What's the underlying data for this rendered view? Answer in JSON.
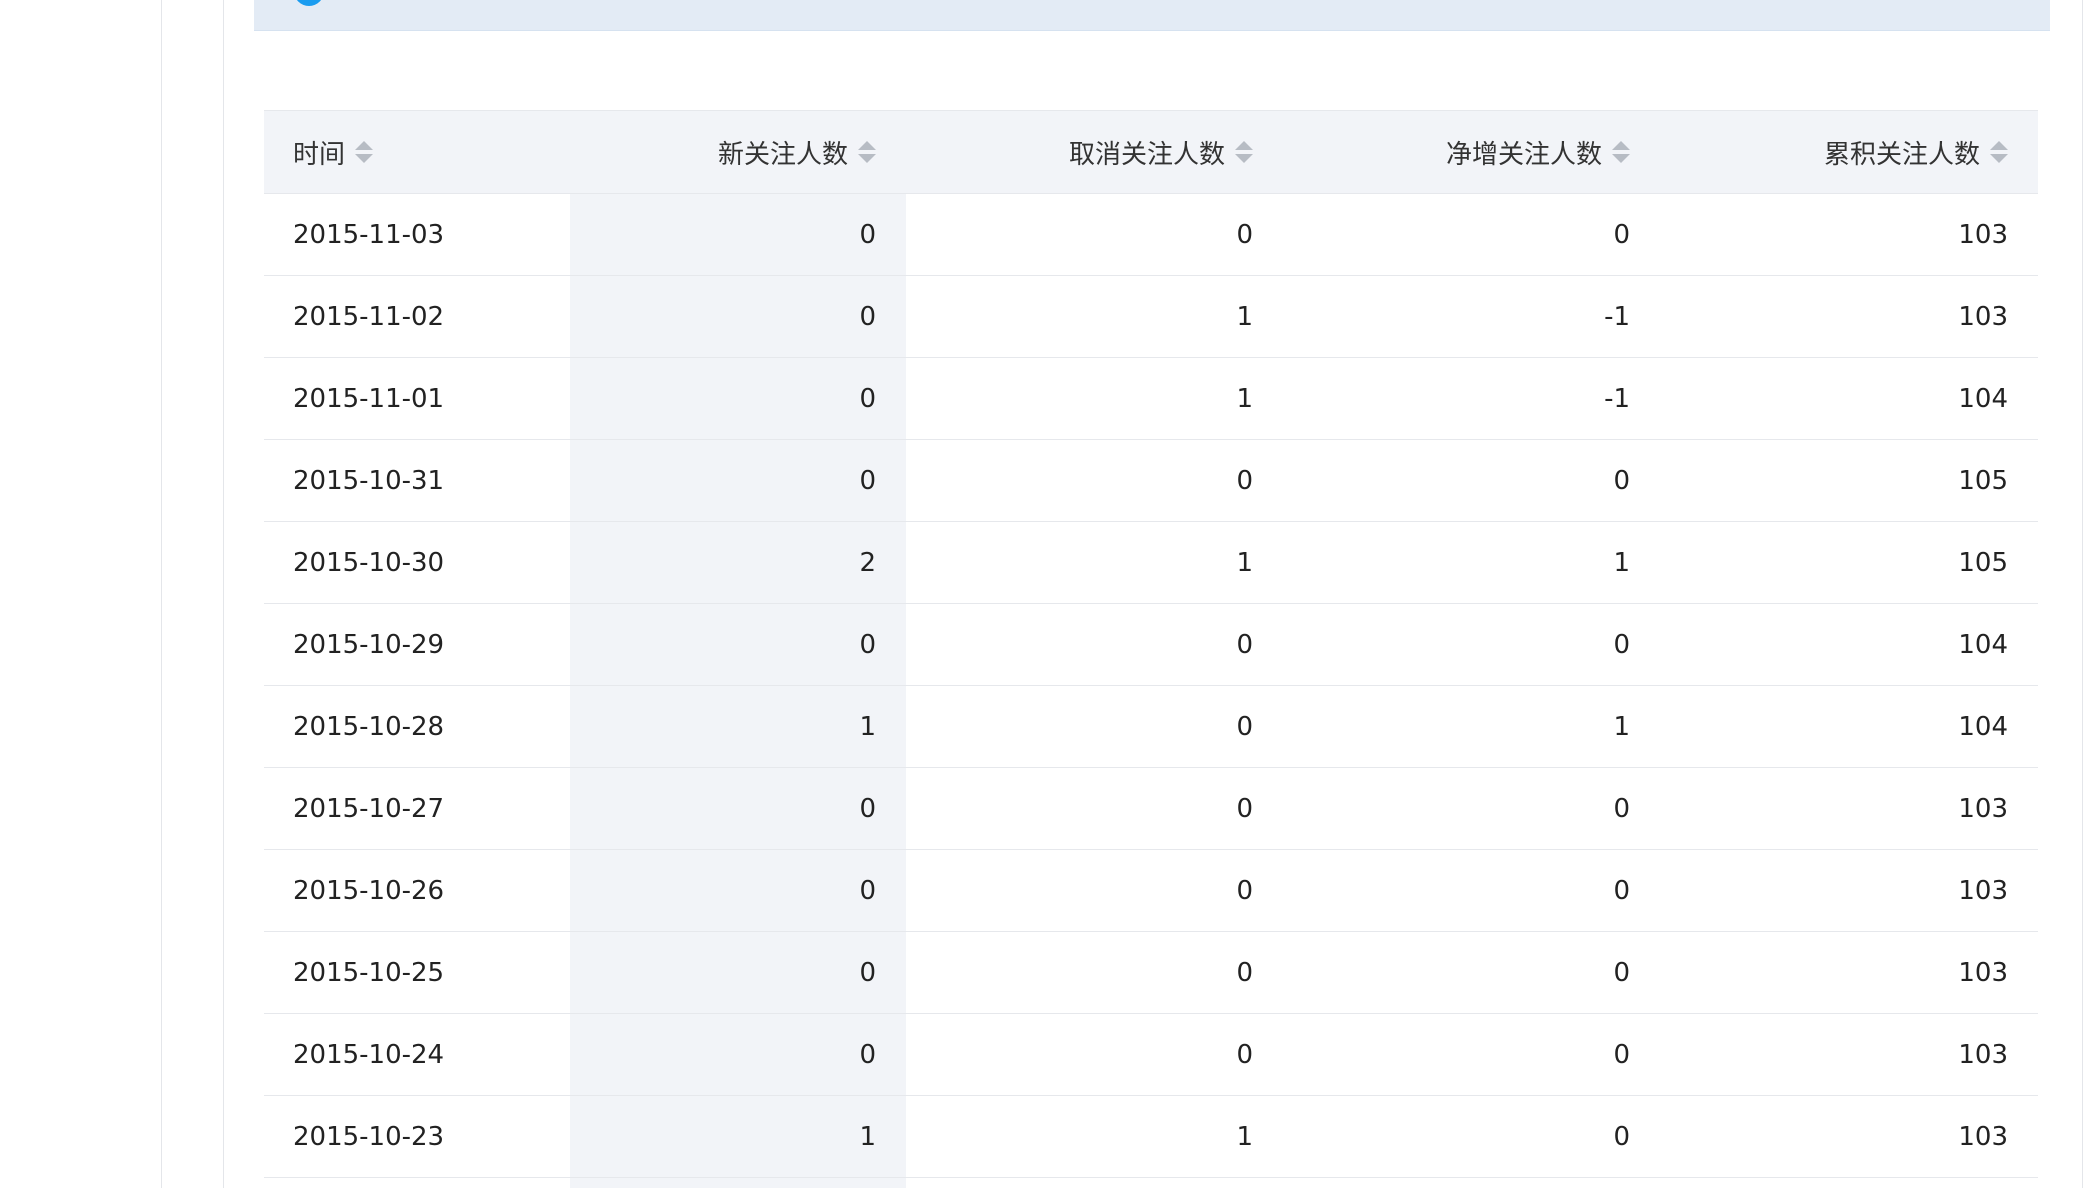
{
  "table": {
    "headers": {
      "date": "时间",
      "new_followers": "新关注人数",
      "cancel_followers": "取消关注人数",
      "net_followers": "净增关注人数",
      "total_followers": "累积关注人数"
    },
    "rows": [
      {
        "date": "2015-11-03",
        "new": "0",
        "cancel": "0",
        "net": "0",
        "total": "103"
      },
      {
        "date": "2015-11-02",
        "new": "0",
        "cancel": "1",
        "net": "-1",
        "total": "103"
      },
      {
        "date": "2015-11-01",
        "new": "0",
        "cancel": "1",
        "net": "-1",
        "total": "104"
      },
      {
        "date": "2015-10-31",
        "new": "0",
        "cancel": "0",
        "net": "0",
        "total": "105"
      },
      {
        "date": "2015-10-30",
        "new": "2",
        "cancel": "1",
        "net": "1",
        "total": "105"
      },
      {
        "date": "2015-10-29",
        "new": "0",
        "cancel": "0",
        "net": "0",
        "total": "104"
      },
      {
        "date": "2015-10-28",
        "new": "1",
        "cancel": "0",
        "net": "1",
        "total": "104"
      },
      {
        "date": "2015-10-27",
        "new": "0",
        "cancel": "0",
        "net": "0",
        "total": "103"
      },
      {
        "date": "2015-10-26",
        "new": "0",
        "cancel": "0",
        "net": "0",
        "total": "103"
      },
      {
        "date": "2015-10-25",
        "new": "0",
        "cancel": "0",
        "net": "0",
        "total": "103"
      },
      {
        "date": "2015-10-24",
        "new": "0",
        "cancel": "0",
        "net": "0",
        "total": "103"
      },
      {
        "date": "2015-10-23",
        "new": "1",
        "cancel": "1",
        "net": "0",
        "total": "103"
      }
    ]
  },
  "colors": {
    "header_bg": "#f2f4f8",
    "sorted_column_bg": "#f2f4f8",
    "info_bar_bg": "#e3ebf5",
    "info_icon": "#1a9cf0",
    "border": "#e6e8ec"
  },
  "icons": {
    "sort": "sort-icon",
    "info": "info-icon"
  }
}
